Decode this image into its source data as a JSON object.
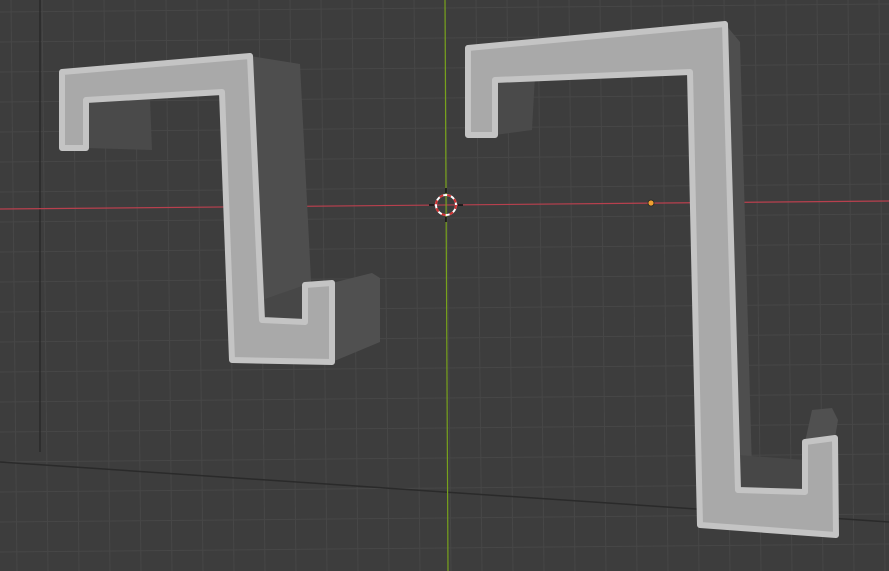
{
  "viewport": {
    "background": "#3d3d3d",
    "grid_color": "#474747",
    "x_axis_color": "#b8404e",
    "y_axis_color": "#78a21c",
    "origin_color": "#f0a030",
    "object_face_color": "#a9a9a9",
    "object_side_color": "#4e4e4e"
  },
  "icons": [
    "3d-cursor-icon",
    "object-origin-icon"
  ]
}
